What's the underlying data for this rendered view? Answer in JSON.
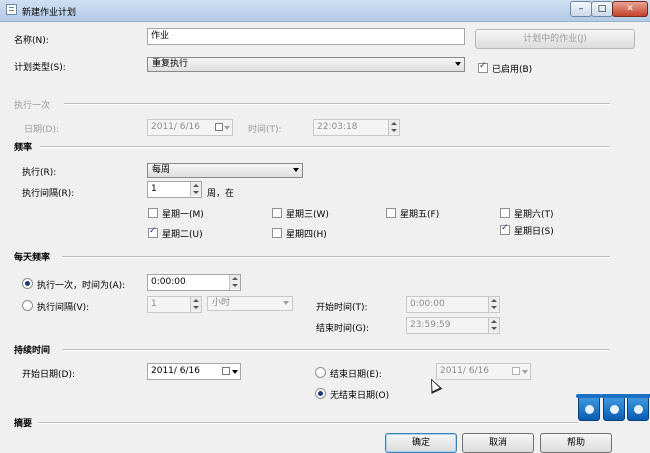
{
  "window": {
    "title": "新建作业计划"
  },
  "name_row": {
    "label": "名称(N):",
    "value": "作业",
    "jobs_button": "计划中的作业(J)"
  },
  "type_row": {
    "label": "计划类型(S):",
    "value": "重复执行",
    "enabled_label": "已启用(B)",
    "enabled": true
  },
  "once": {
    "section": "执行一次",
    "date_label": "日期(D):",
    "date_value": "2011/ 6/16",
    "time_label": "时间(T):",
    "time_value": "22:03:18"
  },
  "frequency": {
    "section": "频率",
    "exec_label": "执行(R):",
    "exec_value": "每周",
    "interval_label": "执行间隔(R):",
    "interval_value": "1",
    "interval_unit": "周，在",
    "days": [
      {
        "label": "星期一(M)",
        "checked": false
      },
      {
        "label": "星期二(U)",
        "checked": true
      },
      {
        "label": "星期三(W)",
        "checked": false
      },
      {
        "label": "星期四(H)",
        "checked": false
      },
      {
        "label": "星期五(F)",
        "checked": false
      },
      {
        "label": "星期六(T)",
        "checked": false
      },
      {
        "label": "星期日(S)",
        "checked": true
      }
    ]
  },
  "daily": {
    "section": "每天频率",
    "once_label": "执行一次，时间为(A):",
    "once_value": "0:00:00",
    "interval_label": "执行间隔(V):",
    "interval_value": "1",
    "interval_unit": "小时",
    "start_label": "开始时间(T):",
    "start_value": "0:00:00",
    "end_label": "结束时间(G):",
    "end_value": "23:59:59"
  },
  "duration": {
    "section": "持续时间",
    "start_label": "开始日期(D):",
    "start_value": "2011/ 6/16",
    "end_label": "结束日期(E):",
    "end_value": "2011/ 6/16",
    "noend_label": "无结束日期(O)"
  },
  "summary": {
    "section": "摘要"
  },
  "buttons": {
    "ok": "确定",
    "cancel": "取消",
    "help": "帮助"
  },
  "icons": [
    "minimize-icon",
    "maximize-icon",
    "close-icon",
    "recycle-bin-icon"
  ]
}
